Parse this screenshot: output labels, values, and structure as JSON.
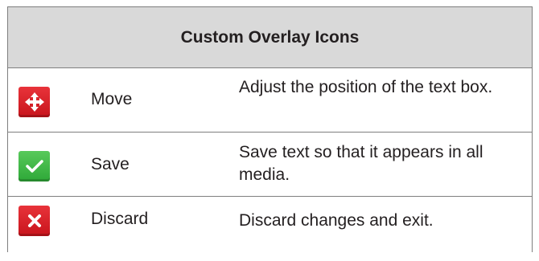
{
  "table": {
    "title": "Custom Overlay Icons",
    "rows": [
      {
        "icon": "move-icon",
        "color": "#d91f26",
        "name": "Move",
        "description": "Adjust the position of the text box."
      },
      {
        "icon": "checkmark-icon",
        "color": "#3bb544",
        "name": "Save",
        "description": "Save text so that it appears in all media."
      },
      {
        "icon": "close-icon",
        "color": "#d91f26",
        "name": "Discard",
        "description": "Discard changes and exit."
      }
    ]
  }
}
